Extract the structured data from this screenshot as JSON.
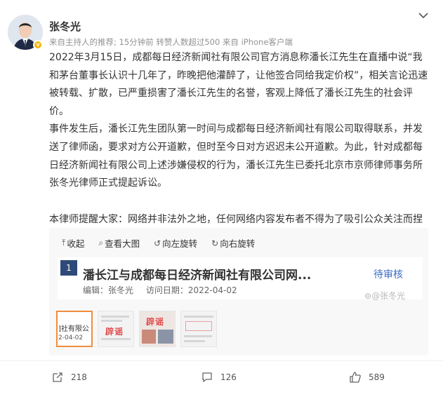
{
  "post": {
    "username": "张冬光",
    "meta": {
      "source": "来自主持人的推荐",
      "sep": ";",
      "time": "15分钟前",
      "reposts": "转赞人数超过500",
      "client": "来自 iPhone客户端"
    },
    "paragraph1": "2022年3月15日，成都每日经济新闻社有限公司官方消息称潘长江先生在直播中说“我和茅台董事长认识十几年了，昨晚把他灌醉了，让他签合同给我定价权”，相关言论迅速被转载、扩散，已严重损害了潘长江先生的名誉，客观上降低了潘长江先生的社会评价。",
    "paragraph2": "事件发生后，潘长江先生团队第一时间与成都每日经济新闻社有限公司取得联系，并发送了律师函，要求对方公开道歉，但时至今日对方迟迟未公开道歉。为此，针对成都每日经济新闻社有限公司上述涉嫌侵权的行为，潘长江先生已委托北京市京师律师事务所张冬光律师正式提起诉讼。",
    "paragraph3": "本律师提醒大家：网络并非法外之地，任何网络内容发布者不得为了吸引公众关注而捏造、歪曲事实、发表严重失实言论，否则将受到法律的制裁。",
    "collapse_label": "收起"
  },
  "media": {
    "toolbar": {
      "collapse": "收起",
      "view_large": "查看大图",
      "rotate_left": "向左旋转",
      "rotate_right": "向右旋转"
    },
    "doc": {
      "number": "1",
      "title": "潘长江与成都每日经济新闻社有限公司网...",
      "status": "待审核",
      "author": "编辑：张冬光",
      "date": "访问日期：2022-04-02"
    },
    "watermark": "@张冬光",
    "thumbs": {
      "t1_line1": "]社有限公",
      "t1_line2": "2-04-02",
      "t2_label": "辟谣",
      "t3_label": "辟谣"
    }
  },
  "actions": {
    "repost_count": "218",
    "comment_count": "126",
    "like_count": "589"
  },
  "icons": {
    "chevron": "chevron-down-icon",
    "repost": "repost-icon",
    "comment": "comment-icon",
    "like": "thumbs-up-icon"
  },
  "colors": {
    "accent_orange": "#eb7350",
    "link_blue": "#3a6bc6",
    "badge_gold": "#f7b500"
  }
}
